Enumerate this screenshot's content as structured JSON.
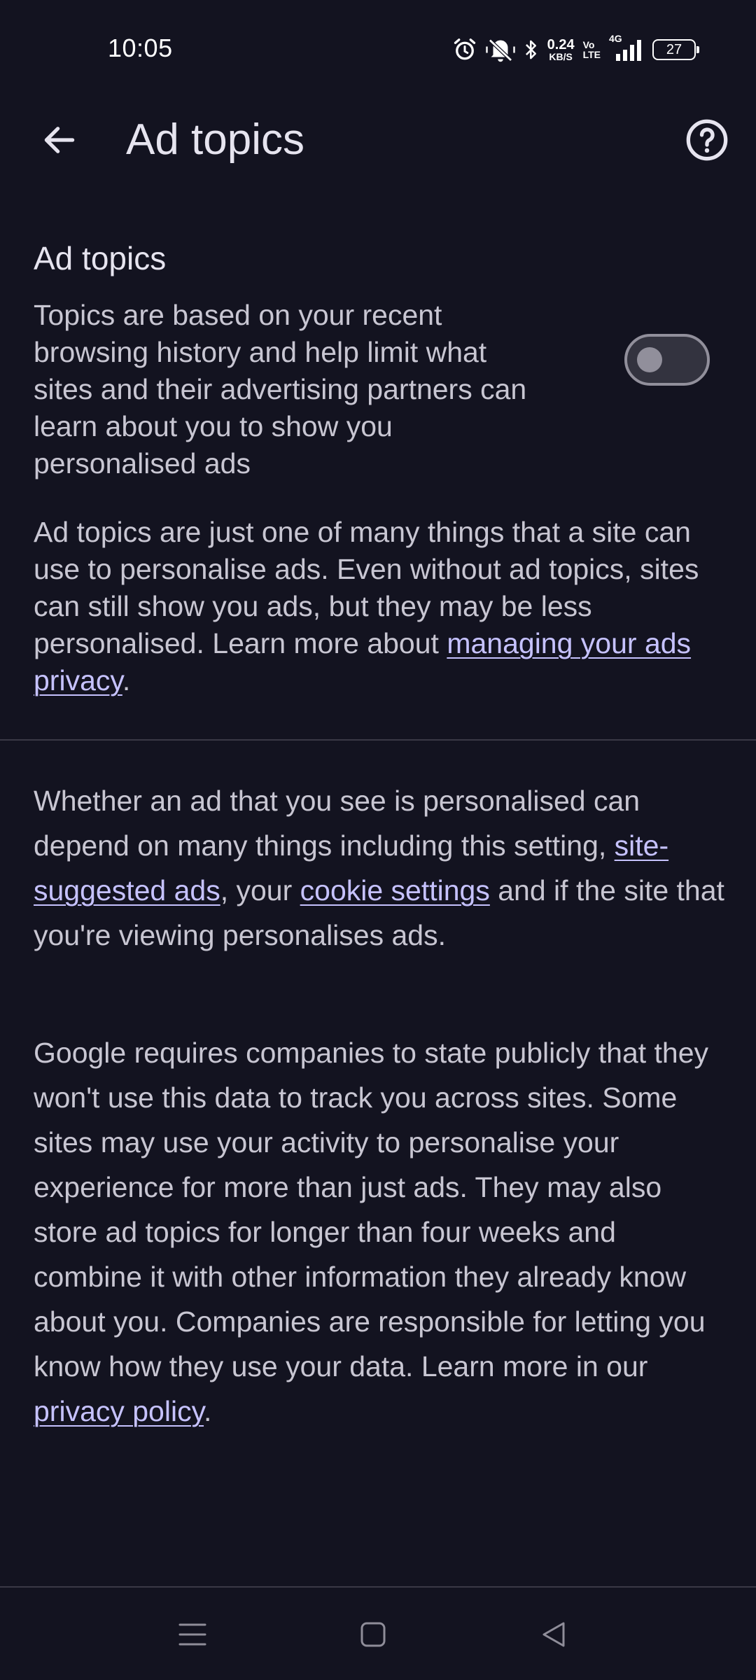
{
  "status_bar": {
    "time": "10:05",
    "net_speed_value": "0.24",
    "net_speed_unit": "KB/S",
    "volte_top": "Vo",
    "volte_bottom": "LTE",
    "network_type": "4G",
    "battery_level": "27",
    "icons": [
      "alarm-icon",
      "vibrate-off-icon",
      "bluetooth-icon",
      "signal-icon",
      "battery-icon"
    ]
  },
  "app_bar": {
    "title": "Ad topics",
    "back_icon": "arrow-back-icon",
    "help_icon": "help-circle-icon"
  },
  "setting": {
    "heading": "Ad topics",
    "description": "Topics are based on your recent browsing history and help limit what sites and their advertising partners can learn about you to show you personalised ads",
    "toggle_on": false
  },
  "paragraph_1": {
    "text": "Ad topics are just one of many things that a site can use to personalise ads. Even without ad topics, sites can still show you ads, but they may be less personalised. Learn more about ",
    "link": "managing your ads privacy",
    "end": "."
  },
  "paragraph_2": {
    "text_a": "Whether an ad that you see is personalised can depend on many things including this setting, ",
    "link_1": "site-suggested ads",
    "text_b": ", your ",
    "link_2": "cookie settings",
    "text_c": " and if the site that you're viewing personalises ads."
  },
  "paragraph_3": {
    "text": "Google requires companies to state publicly that they won't use this data to track you across sites. Some sites may use your activity to personalise your experience for more than just ads. They may also store ad topics for longer than four weeks and combine it with other information they already know about you. Companies are responsible for letting you know how they use your data. Learn more in our ",
    "link": "privacy policy",
    "end": "."
  },
  "nav_bar": {
    "icons": [
      "menu-icon",
      "home-icon",
      "back-triangle-icon"
    ]
  },
  "colors": {
    "background": "#131320",
    "text": "#c8c6d2",
    "link": "#c6c2ff",
    "toggle_outline": "#918f9b"
  }
}
